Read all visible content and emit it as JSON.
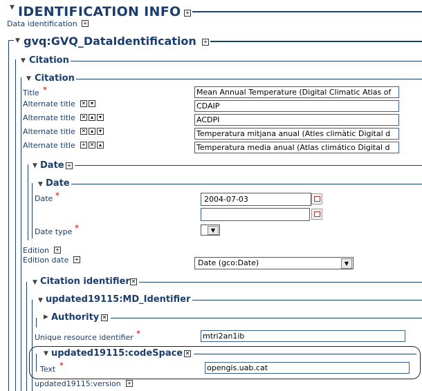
{
  "header": {
    "title": "IDENTIFICATION INFO",
    "subtitle": "Data identification"
  },
  "section": {
    "title": "gvq:GVQ_DataIdentification"
  },
  "citation_outer": {
    "title": "Citation"
  },
  "citation_inner": {
    "title": "Citation"
  },
  "fields": {
    "title": {
      "label": "Title",
      "value": "Mean Annual Temperature (Digital Climatic Atlas of"
    },
    "alt1": {
      "label": "Alternate title",
      "value": "CDAIP"
    },
    "alt2": {
      "label": "Alternate title",
      "value": "ACDPI"
    },
    "alt3": {
      "label": "Alternate title",
      "value": "Temperatura mitjana anual (Atles climàtic Digital d"
    },
    "alt4": {
      "label": "Alternate title",
      "value": "Temperatura media anual (Atlas climático Digital d"
    }
  },
  "date_outer": {
    "title": "Date"
  },
  "date_inner": {
    "title": "Date"
  },
  "date": {
    "label": "Date",
    "value": "2004-07-03",
    "value2": "",
    "type_label": "Date type",
    "type_value": ""
  },
  "edition": {
    "label": "Edition",
    "date_label": "Edition date",
    "date_select": "Date (gco:Date)"
  },
  "citation_identifier": {
    "title": "Citation identifier"
  },
  "md_identifier": {
    "title": "updated19115:MD_Identifier"
  },
  "authority": {
    "title": "Authority"
  },
  "unique_id": {
    "label": "Unique resource identifier",
    "value": "mtri2an1ib"
  },
  "code_space": {
    "title": "updated19115:codeSpace",
    "text_label": "Text",
    "text_value": "opengis.uab.cat"
  },
  "version": {
    "label": "updated19115:version"
  },
  "icons": {
    "expand": "plus-box",
    "remove": "x-box",
    "up": "arrow-up-box",
    "down": "arrow-down-box",
    "collapse": "triangle-down",
    "expand_section": "triangle-right"
  },
  "colors": {
    "heading": "#1a3d6e",
    "required": "#dd0000"
  }
}
